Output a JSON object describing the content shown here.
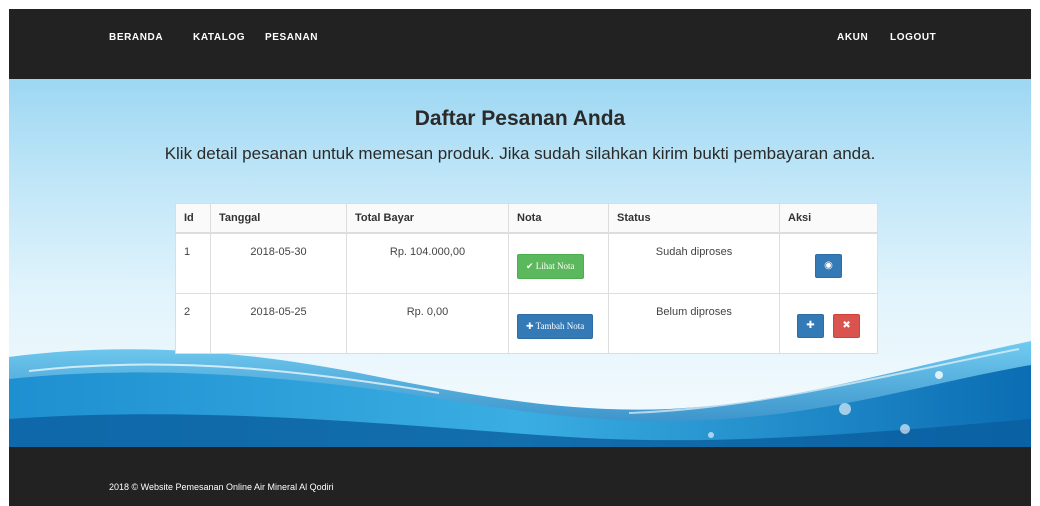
{
  "navbar": {
    "left_links": [
      {
        "label": "BERANDA"
      },
      {
        "label": "KATALOG"
      },
      {
        "label": "PESANAN"
      }
    ],
    "right_links": [
      {
        "label": "AKUN"
      },
      {
        "label": "LOGOUT"
      }
    ]
  },
  "hero": {
    "title": "Daftar Pesanan Anda",
    "subtitle": "Klik detail pesanan untuk memesan produk. Jika sudah silahkan kirim bukti pembayaran anda."
  },
  "table": {
    "headers": [
      "Id",
      "Tanggal",
      "Total Bayar",
      "Nota",
      "Status",
      "Aksi"
    ],
    "rows": [
      {
        "id": "1",
        "tanggal": "2018-05-30",
        "total": "Rp. 104.000,00",
        "nota_label": "Lihat Nota",
        "nota_icon": "check-icon",
        "status": "Sudah diproses",
        "actions": [
          "eye-icon"
        ]
      },
      {
        "id": "2",
        "tanggal": "2018-05-25",
        "total": "Rp. 0,00",
        "nota_label": "Tambah Nota",
        "nota_icon": "plus-icon",
        "status": "Belum diproses",
        "actions": [
          "plus-icon",
          "times-icon"
        ]
      }
    ]
  },
  "footer": {
    "text": "2018 © Website Pemesanan Online Air Mineral Al Qodiri"
  },
  "colors": {
    "navbar_bg": "#222222",
    "success": "#5cb85c",
    "primary": "#337ab7",
    "danger": "#d9534f"
  }
}
